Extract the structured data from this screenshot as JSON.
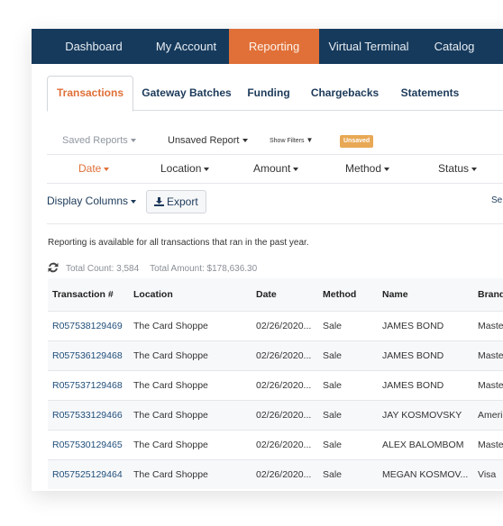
{
  "nav": {
    "items": [
      {
        "label": "Dashboard",
        "active": false
      },
      {
        "label": "My Account",
        "active": false
      },
      {
        "label": "Reporting",
        "active": true
      },
      {
        "label": "Virtual Terminal",
        "active": false
      },
      {
        "label": "Catalog",
        "active": false
      }
    ]
  },
  "subtabs": [
    {
      "label": "Transactions",
      "active": true
    },
    {
      "label": "Gateway Batches",
      "active": false
    },
    {
      "label": "Funding",
      "active": false
    },
    {
      "label": "Chargebacks",
      "active": false
    },
    {
      "label": "Statements",
      "active": false
    }
  ],
  "reportbar": {
    "saved_reports": "Saved Reports",
    "unsaved_report": "Unsaved Report",
    "show_filters": "Show Filters",
    "badge": "Unsaved"
  },
  "filters": [
    {
      "label": "Date",
      "active": true
    },
    {
      "label": "Location",
      "active": false
    },
    {
      "label": "Amount",
      "active": false
    },
    {
      "label": "Method",
      "active": false
    },
    {
      "label": "Status",
      "active": false
    }
  ],
  "toolbar": {
    "display_columns": "Display Columns",
    "export": "Export",
    "search_partial": "Se"
  },
  "info_text": "Reporting is available for all transactions that ran in the past year.",
  "totals": {
    "count": "Total Count: 3,584",
    "amount": "Total Amount: $178,636.30"
  },
  "colors": {
    "nav_bg": "#163a5c",
    "accent": "#e07038",
    "link": "#1f4e79",
    "badge": "#e8a855"
  },
  "table": {
    "columns": [
      "Transaction #",
      "Location",
      "Date",
      "Method",
      "Name",
      "Brand"
    ],
    "rows": [
      [
        "R057538129469",
        "The Card Shoppe",
        "02/26/2020...",
        "Sale",
        "JAMES BOND",
        "Maste"
      ],
      [
        "R057536129468",
        "The Card Shoppe",
        "02/26/2020...",
        "Sale",
        "JAMES BOND",
        "Maste"
      ],
      [
        "R057537129468",
        "The Card Shoppe",
        "02/26/2020...",
        "Sale",
        "JAMES BOND",
        "Maste"
      ],
      [
        "R057533129466",
        "The Card Shoppe",
        "02/26/2020...",
        "Sale",
        "JAY KOSMOVSKY",
        "Ameri"
      ],
      [
        "R057530129465",
        "The Card Shoppe",
        "02/26/2020...",
        "Sale",
        "ALEX BALOMBOM",
        "Maste"
      ],
      [
        "R057525129464",
        "The Card Shoppe",
        "02/26/2020...",
        "Sale",
        "MEGAN KOSMOV...",
        "Visa"
      ]
    ]
  }
}
